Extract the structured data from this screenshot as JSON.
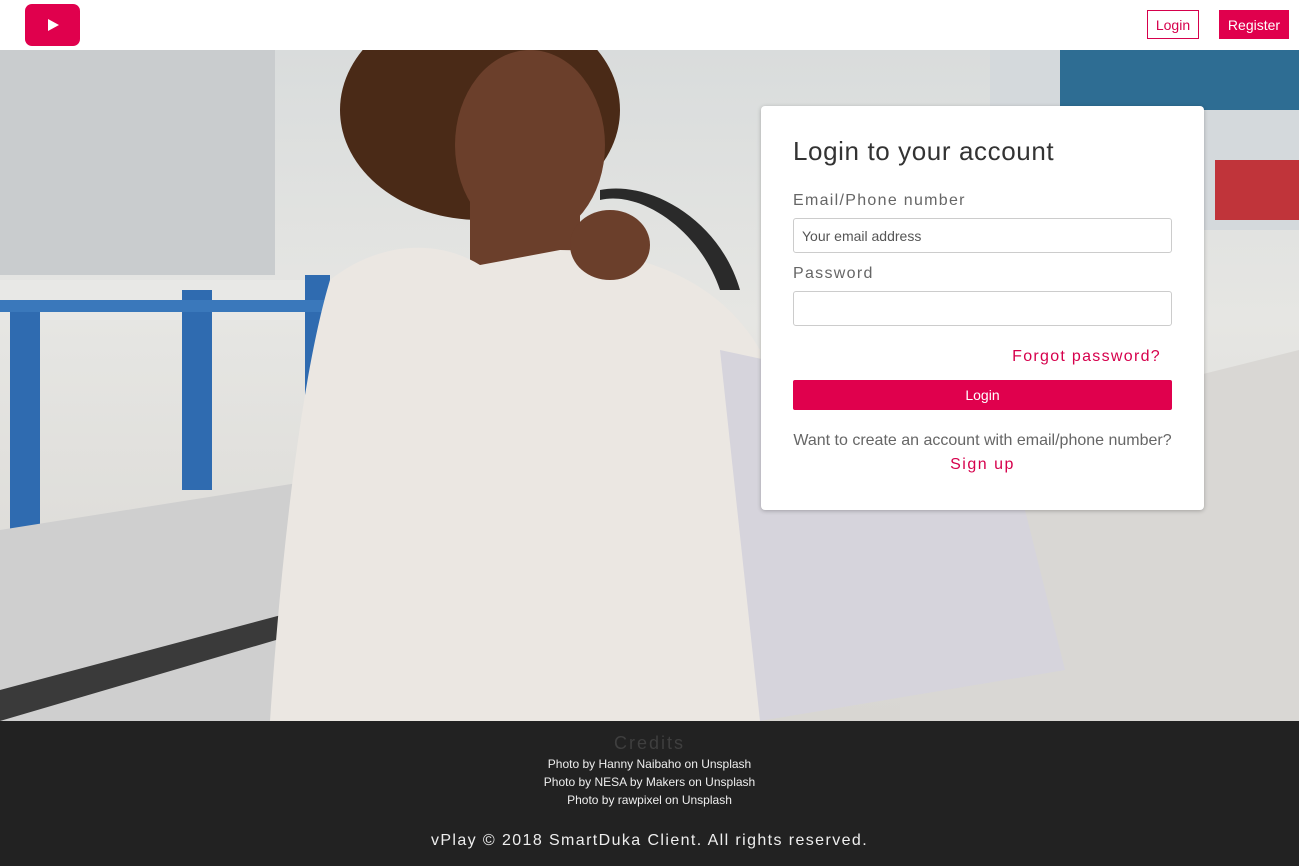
{
  "header": {
    "logo_icon": "play-icon",
    "login_label": "Login",
    "register_label": "Register"
  },
  "login_card": {
    "title": "Login to your account",
    "email_label": "Email/Phone number",
    "email_placeholder": "Your email address",
    "email_value": "",
    "password_label": "Password",
    "password_value": "",
    "forgot_label": "Forgot password?",
    "login_button": "Login",
    "prompt_text": "Want to create an account with email/phone number?",
    "signup_label": "Sign up"
  },
  "footer": {
    "credits_title": "Credits",
    "credits": [
      "Photo by Hanny Naibaho on Unsplash",
      "Photo by NESA by Makers on Unsplash",
      "Photo by rawpixel on Unsplash"
    ],
    "copyright": "vPlay © 2018 SmartDuka Client. All rights reserved."
  },
  "colors": {
    "accent": "#e0004d",
    "footer_bg": "#222222"
  }
}
